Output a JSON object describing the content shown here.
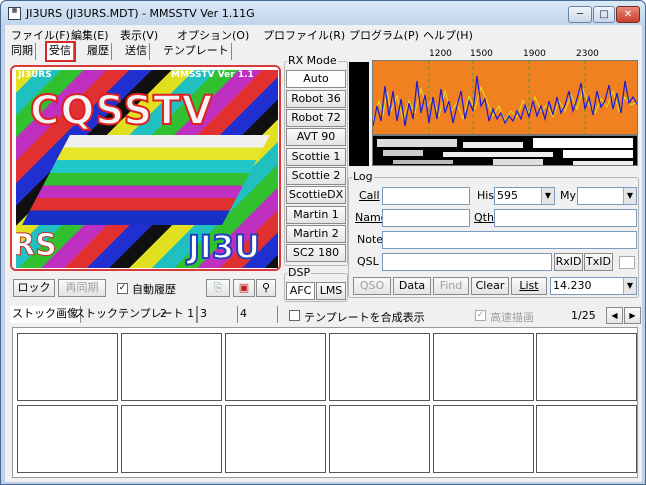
{
  "window": {
    "title": "JI3URS (JI3URS.MDT) - MMSSTV Ver 1.11G",
    "controls": {
      "minimize": "─",
      "maximize": "□",
      "close": "✕"
    }
  },
  "menu": [
    "ファイル(F)",
    "編集(E)",
    "表示(V)",
    "オプション(O)",
    "プロファイル(R)",
    "プログラム(P)",
    "ヘルプ(H)"
  ],
  "tabs": [
    "同期",
    "受信",
    "履歴",
    "送信",
    "テンプレート"
  ],
  "image_text": {
    "callsign": "CQSSTV",
    "corner_left": "RS",
    "corner_right": "JI3U",
    "top_left": "JI3URS",
    "top_right": "MMSSTV Ver 1.1"
  },
  "rx_mode": {
    "label": "RX Mode",
    "modes": [
      "Auto",
      "Robot 36",
      "Robot 72",
      "AVT 90",
      "Scottie 1",
      "Scottie 2",
      "ScottieDX",
      "Martin 1",
      "Martin 2",
      "SC2 180"
    ]
  },
  "dsp": {
    "label": "DSP",
    "afc": "AFC",
    "lms": "LMS"
  },
  "bottom_controls": {
    "lock": "ロック",
    "resync": "再同期",
    "auto_history": "自動履歴"
  },
  "spectrum": {
    "freq_labels": [
      "1200",
      "1500",
      "1900",
      "2300"
    ],
    "colors": {
      "scope_bg": "#f08020",
      "trace": "#1a1ad8"
    }
  },
  "log": {
    "label": "Log",
    "call_label": "Call",
    "call_value": "",
    "his_label": "His",
    "his_value": "595",
    "my_label": "My",
    "my_value": "",
    "name_label": "Name",
    "name_value": "",
    "qth_label": "Qth",
    "qth_value": "",
    "note_label": "Note",
    "note_value": "",
    "qsl_label": "QSL",
    "qsl_value": "",
    "rxid": "RxID",
    "txid": "TxID"
  },
  "log_buttons": {
    "qso": "QSO",
    "data": "Data",
    "find": "Find",
    "clear": "Clear",
    "list": "List",
    "freq": "14.230"
  },
  "stock": {
    "tabs": [
      "ストック画像",
      "ストックテンプレート 1",
      "2",
      "3",
      "4"
    ],
    "composite_label": "テンプレートを合成表示",
    "fast_draw_label": "高速描画",
    "page": "1/25"
  }
}
